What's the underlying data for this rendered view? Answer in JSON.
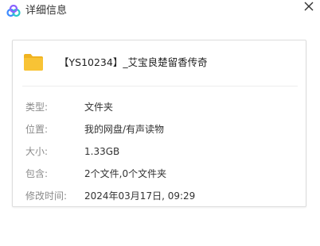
{
  "window": {
    "title": "详细信息",
    "close_label": "✕",
    "logo_icon": "cloud-logo-icon"
  },
  "file": {
    "icon": "folder-icon",
    "name": "【YS10234】_艾宝良楚留香传奇"
  },
  "details": [
    {
      "label": "类型:",
      "value": "文件夹"
    },
    {
      "label": "位置:",
      "value": "我的网盘/有声读物"
    },
    {
      "label": "大小:",
      "value": "1.33GB"
    },
    {
      "label": "包含:",
      "value": "2个文件,0个文件夹"
    },
    {
      "label": "修改时间:",
      "value": "2024年03月17日, 09:29"
    }
  ],
  "colors": {
    "folder": "#f8c335",
    "logo_blue": "#3d8bff",
    "logo_purple": "#8a63ff",
    "logo_teal": "#2cc6c9"
  }
}
